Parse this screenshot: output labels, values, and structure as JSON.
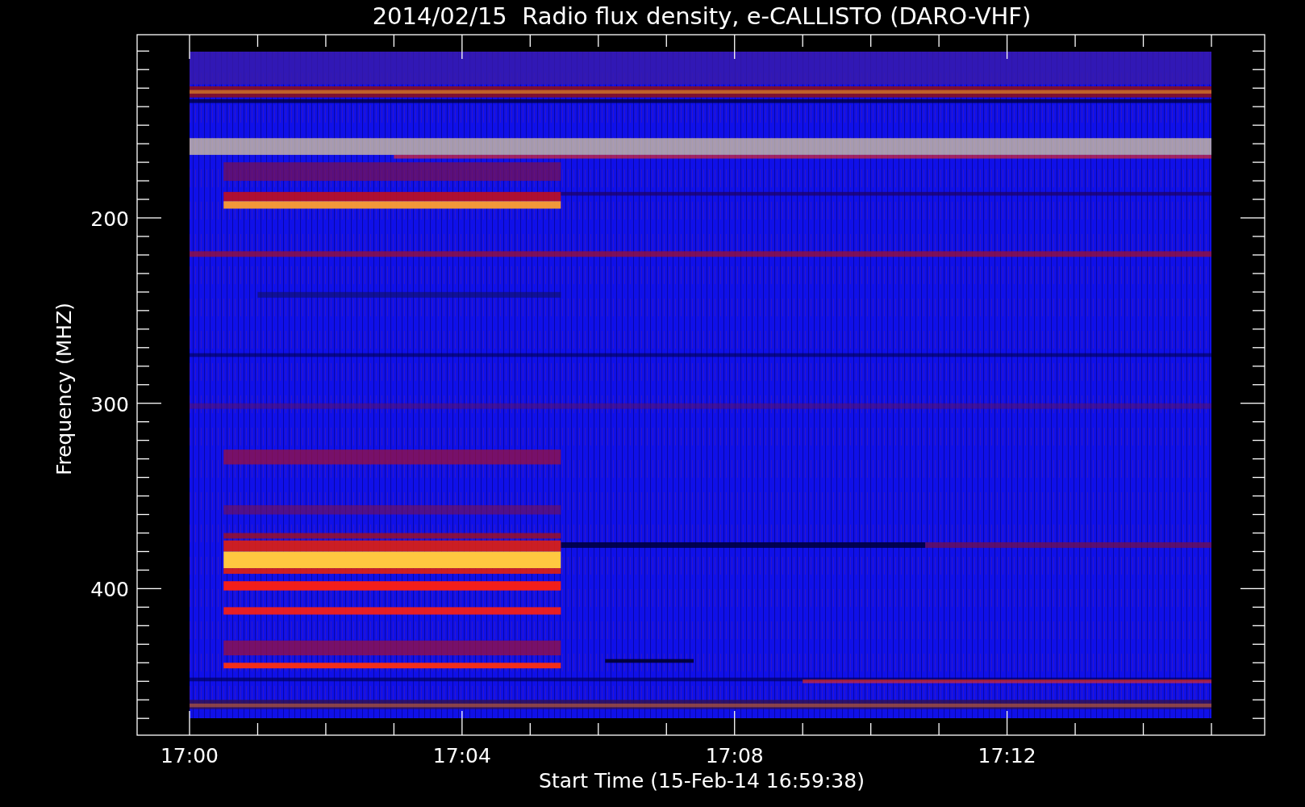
{
  "title": "2014/02/15  Radio flux density, e-CALLISTO (DARO-VHF)",
  "y_axis": {
    "title": "Frequency (MHZ)",
    "ticks": [
      "200",
      "300",
      "400"
    ]
  },
  "x_axis": {
    "title": "Start Time (15-Feb-14 16:59:38)",
    "ticks": [
      "17:00",
      "17:04",
      "17:08",
      "17:12"
    ]
  }
}
